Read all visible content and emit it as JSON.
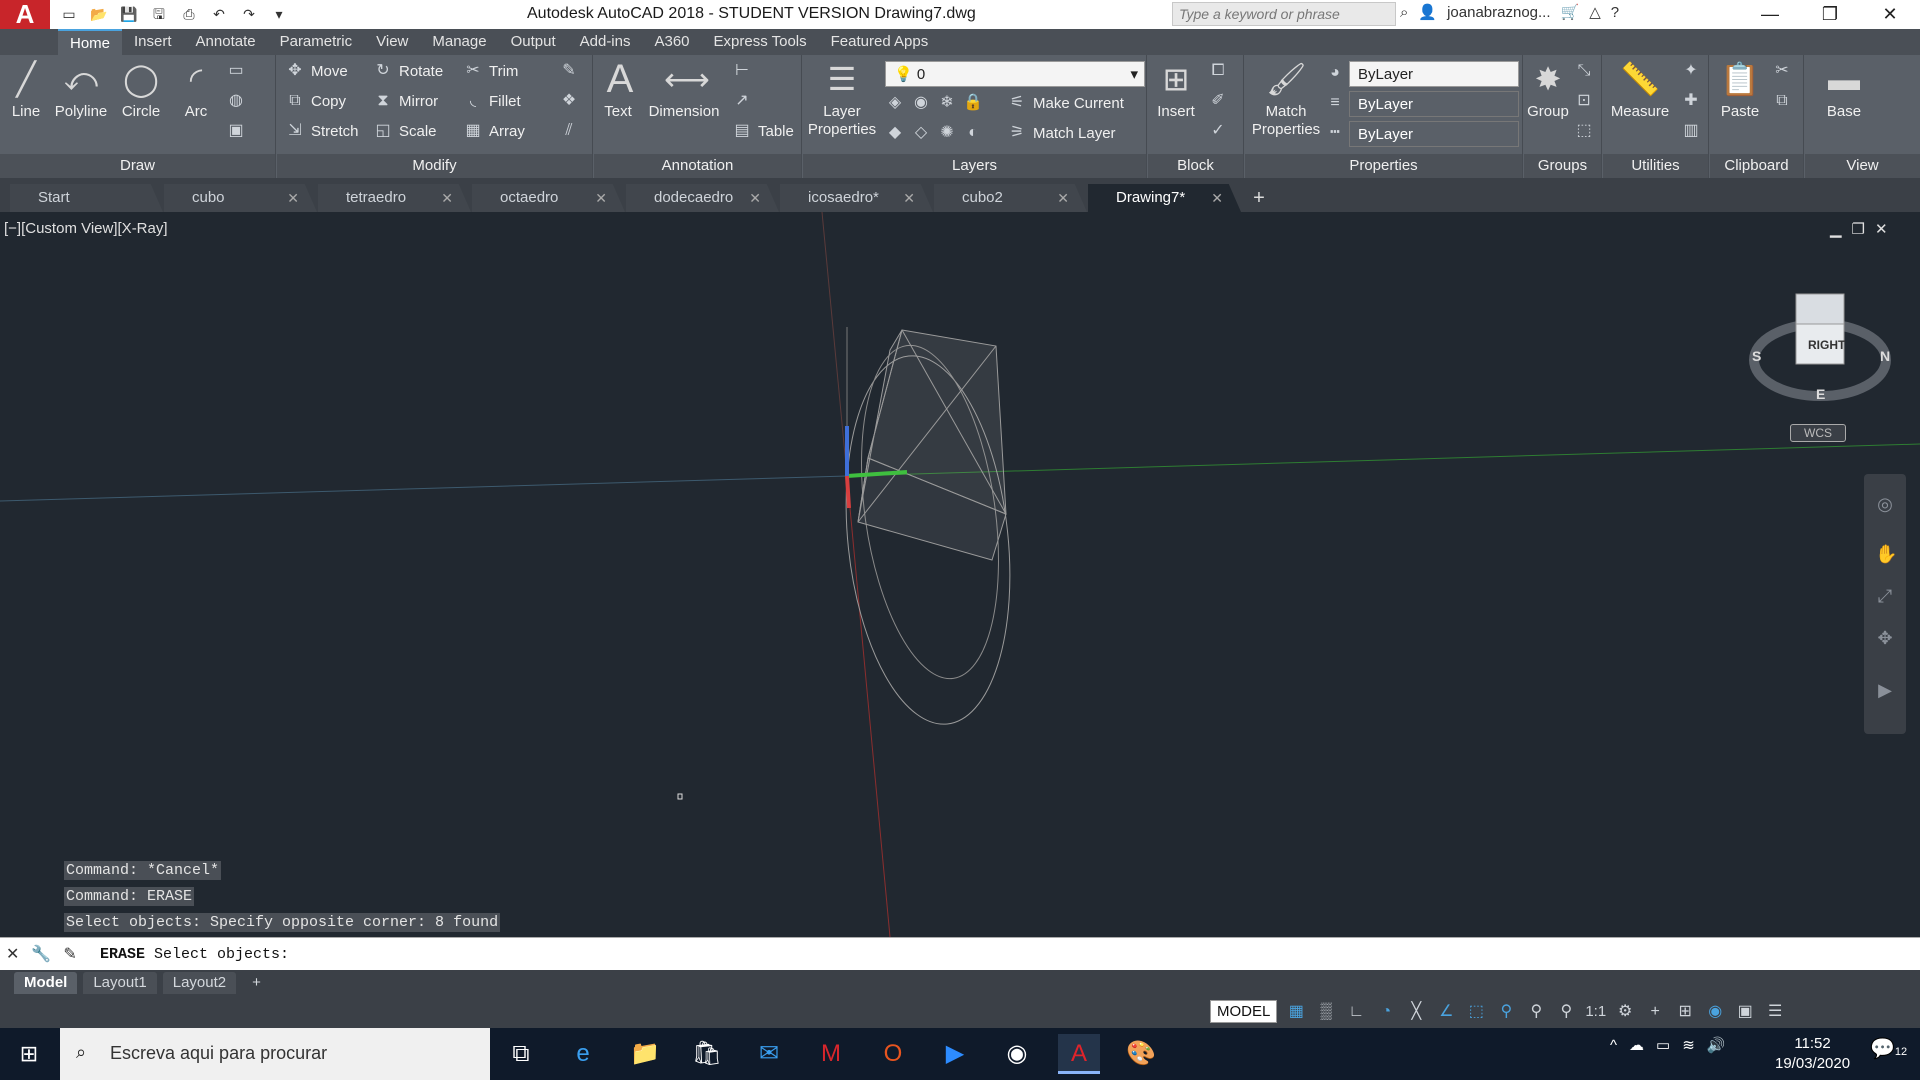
{
  "titlebar": {
    "logo": "A",
    "title": "Autodesk AutoCAD 2018 - STUDENT VERSION    Drawing7.dwg",
    "search_placeholder": "Type a keyword or phrase",
    "user": "joanabraznog...",
    "window_controls": [
      "minimize-icon",
      "restore-icon",
      "close-icon"
    ]
  },
  "ribbon_tabs": [
    "Home",
    "Insert",
    "Annotate",
    "Parametric",
    "View",
    "Manage",
    "Output",
    "Add-ins",
    "A360",
    "Express Tools",
    "Featured Apps"
  ],
  "ribbon": {
    "draw": {
      "title": "Draw",
      "line": "Line",
      "polyline": "Polyline",
      "circle": "Circle",
      "arc": "Arc"
    },
    "modify": {
      "title": "Modify",
      "move": "Move",
      "rotate": "Rotate",
      "trim": "Trim",
      "copy": "Copy",
      "mirror": "Mirror",
      "fillet": "Fillet",
      "stretch": "Stretch",
      "scale": "Scale",
      "array": "Array"
    },
    "annotation": {
      "title": "Annotation",
      "text": "Text",
      "dimension": "Dimension",
      "table": "Table"
    },
    "layers": {
      "title": "Layers",
      "layer_properties": "Layer Properties",
      "current_layer": "0",
      "make_current": "Make Current",
      "match_layer": "Match Layer"
    },
    "block": {
      "title": "Block",
      "insert": "Insert"
    },
    "properties": {
      "title": "Properties",
      "match_properties": "Match Properties",
      "color": "ByLayer",
      "linetype": "ByLayer",
      "lineweight": "ByLayer"
    },
    "groups": {
      "title": "Groups",
      "group": "Group"
    },
    "utilities": {
      "title": "Utilities",
      "measure": "Measure"
    },
    "clipboard": {
      "title": "Clipboard",
      "paste": "Paste"
    },
    "view": {
      "title": "View",
      "base": "Base"
    }
  },
  "file_tabs": [
    "Start",
    "cubo",
    "tetraedro",
    "octaedro",
    "dodecaedro",
    "icosaedro*",
    "cubo2",
    "Drawing7*"
  ],
  "viewport": {
    "label": "[−][Custom View][X-Ray]",
    "viewcube_face": "RIGHT",
    "compass": {
      "s": "S",
      "n": "N",
      "e": "E"
    },
    "wcs": "WCS"
  },
  "command_history": [
    "Command: *Cancel*",
    "Command: ERASE",
    "Select objects: Specify opposite corner: 8 found"
  ],
  "command_line": {
    "keyword": "ERASE",
    "prompt": " Select objects:"
  },
  "layout_tabs": [
    "Model",
    "Layout1",
    "Layout2"
  ],
  "status_bar": {
    "model": "MODEL",
    "scale": "1:1"
  },
  "taskbar": {
    "search_placeholder": "Escreva aqui para procurar",
    "time": "11:52",
    "date": "19/03/2020",
    "notifications": "12"
  }
}
